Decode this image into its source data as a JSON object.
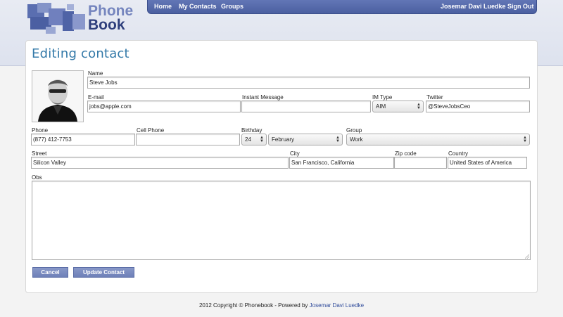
{
  "logo": {
    "line1": "Phone",
    "line2": "Book"
  },
  "nav": {
    "home": "Home",
    "my_contacts": "My Contacts",
    "groups": "Groups",
    "user": "Josemar Davi Luedke",
    "sign_out": "Sign Out"
  },
  "page": {
    "title": "Editing contact"
  },
  "form": {
    "name": {
      "label": "Name",
      "value": "Steve Jobs"
    },
    "email": {
      "label": "E-mail",
      "value": "jobs@apple.com"
    },
    "im": {
      "label": "Instant Message",
      "value": ""
    },
    "im_type": {
      "label": "IM Type",
      "value": "AIM"
    },
    "twitter": {
      "label": "Twitter",
      "value": "@SteveJobsCeo"
    },
    "phone": {
      "label": "Phone",
      "value": "(877) 412-7753"
    },
    "cell": {
      "label": "Cell Phone",
      "value": ""
    },
    "birthday": {
      "label": "Birthday",
      "day": "24",
      "month": "February"
    },
    "group": {
      "label": "Group",
      "value": "Work"
    },
    "street": {
      "label": "Street",
      "value": "Silicon Valley"
    },
    "city": {
      "label": "City",
      "value": "San Francisco, California"
    },
    "zip": {
      "label": "Zip code",
      "value": ""
    },
    "country": {
      "label": "Country",
      "value": "United States of America"
    },
    "obs": {
      "label": "Obs",
      "value": ""
    }
  },
  "buttons": {
    "cancel": "Cancel",
    "update": "Update Contact"
  },
  "footer": {
    "text": "2012 Copyright © Phonebook - Powered by ",
    "link": "Josemar Davi Luedke"
  },
  "colors": {
    "nav": "#5468aa",
    "title": "#3379a8",
    "button": "#7b8cc0"
  }
}
